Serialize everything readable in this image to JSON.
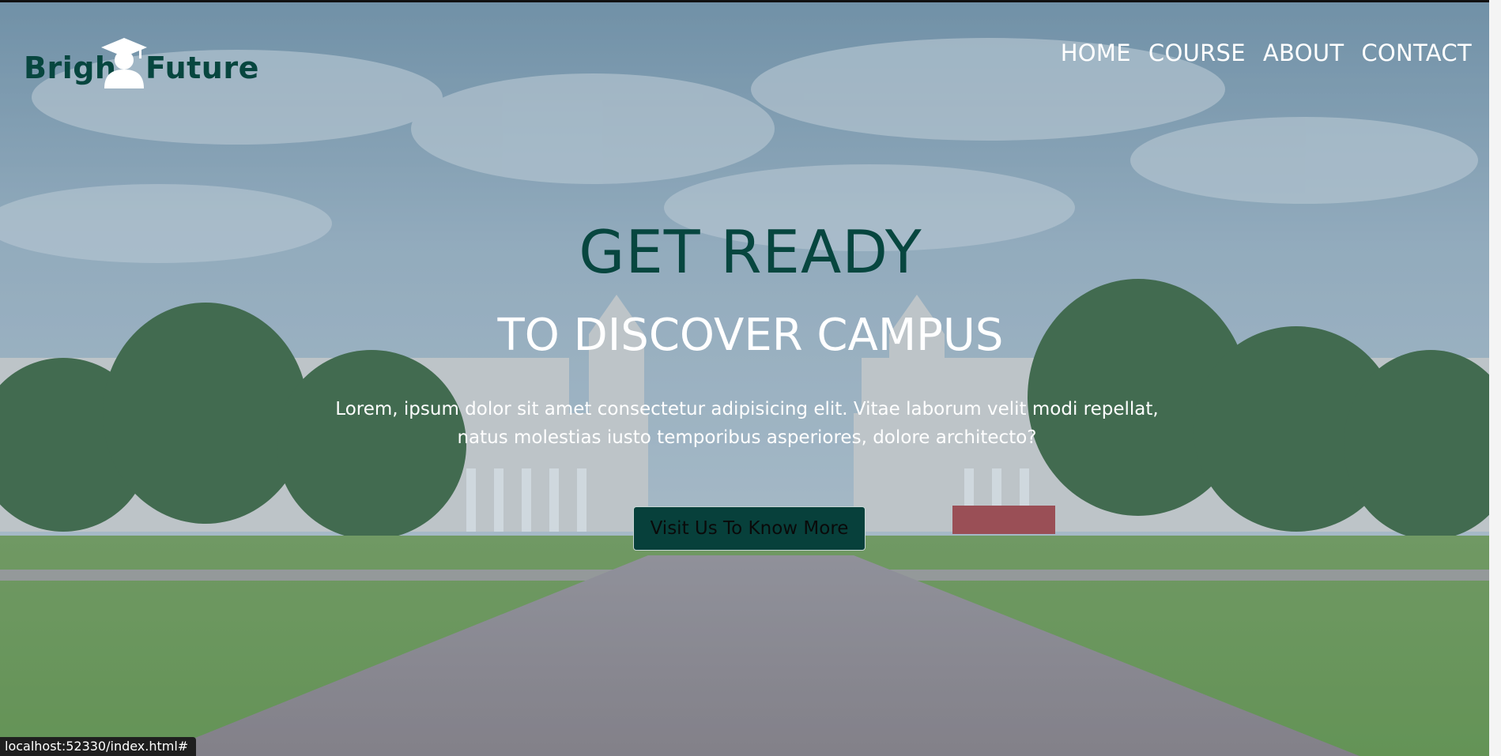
{
  "logo": {
    "left_text": "Brigh",
    "right_text": "Future",
    "icon": "graduate-icon"
  },
  "nav": {
    "items": [
      {
        "label": "HOME"
      },
      {
        "label": "COURSE"
      },
      {
        "label": "ABOUT"
      },
      {
        "label": "CONTACT"
      }
    ]
  },
  "hero": {
    "title": "GET READY",
    "subtitle": "TO DISCOVER CAMPUS",
    "text_line1": "Lorem, ipsum dolor sit amet consectetur adipisicing elit. Vitae laborum velit modi repellat,",
    "text_line2": "natus molestias iusto temporibus asperiores, dolore architecto?",
    "button_label": "Visit Us To Know More"
  },
  "status_bar": {
    "url": "localhost:52330/index.html#"
  },
  "colors": {
    "brand": "#07463f",
    "button_bg": "#07403b",
    "nav_text": "#ffffff"
  }
}
